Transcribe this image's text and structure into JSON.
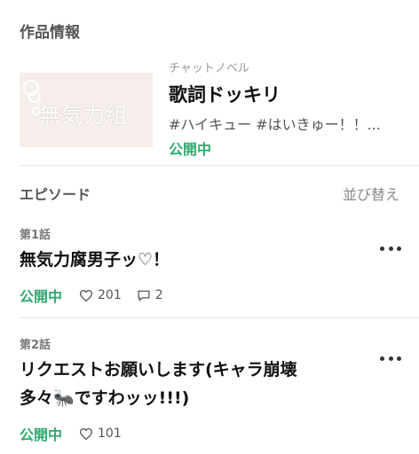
{
  "work_section": {
    "title": "作品情報"
  },
  "work": {
    "thumbnail_text": "無気力組",
    "category": "チャットノベル",
    "title": "歌詞ドッキリ",
    "tags": "#ハイキュー #はいきゅー！！...",
    "status": "公開中"
  },
  "episodes_section": {
    "title": "エピソード",
    "sort_label": "並び替え"
  },
  "episodes": [
    {
      "number": "第1話",
      "title": "無気力腐男子ッ♡！",
      "status": "公開中",
      "likes": "201",
      "comments": "2"
    },
    {
      "number": "第2話",
      "title_line1": "リクエストお願いします(キャラ崩壊",
      "title_line2": "多々🐜ですわッッ!!!)",
      "status": "公開中",
      "likes": "101"
    }
  ],
  "icons": {
    "heart": "heart-icon",
    "comment": "comment-icon",
    "more": "more-icon"
  },
  "colors": {
    "status_green": "#2fa86f",
    "thumbnail_bg": "#f6eeea"
  }
}
